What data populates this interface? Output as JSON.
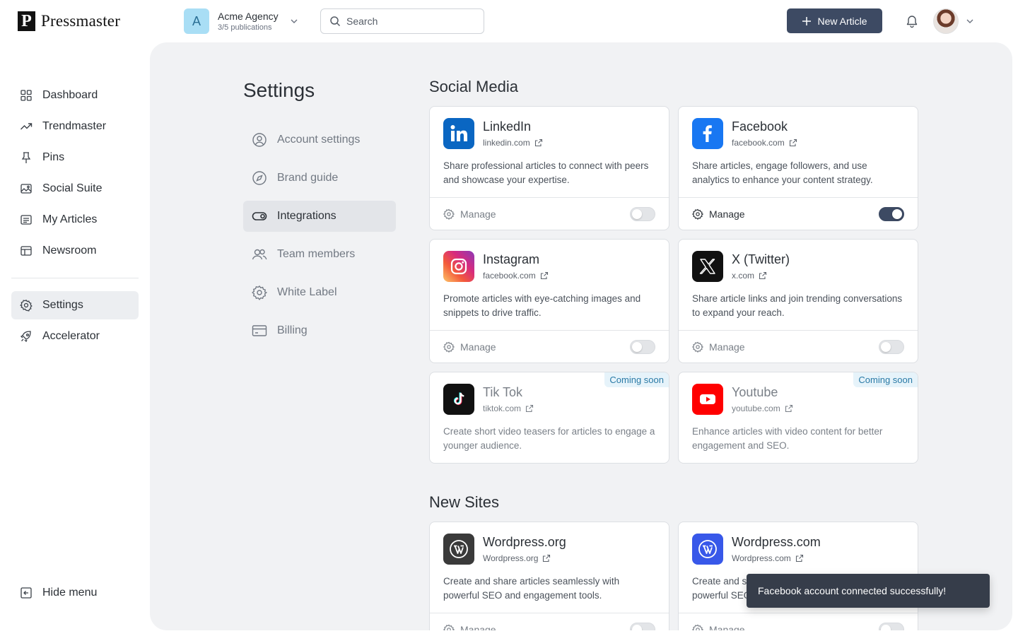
{
  "app": {
    "name": "Pressmaster",
    "logo_letter": "P"
  },
  "org": {
    "avatar": "A",
    "name": "Acme Agency",
    "subtitle": "3/5 publications"
  },
  "search": {
    "placeholder": "Search"
  },
  "header": {
    "new_article_label": "New Article"
  },
  "sidebar": {
    "items": [
      {
        "label": "Dashboard",
        "icon": "grid-icon"
      },
      {
        "label": "Trendmaster",
        "icon": "trend-icon"
      },
      {
        "label": "Pins",
        "icon": "pin-icon"
      },
      {
        "label": "Social Suite",
        "icon": "image-icon"
      },
      {
        "label": "My Articles",
        "icon": "articles-icon"
      },
      {
        "label": "Newsroom",
        "icon": "layout-icon"
      }
    ],
    "secondary": [
      {
        "label": "Settings",
        "icon": "gear-icon",
        "active": true
      },
      {
        "label": "Accelerator",
        "icon": "rocket-icon"
      }
    ],
    "hide_menu": "Hide menu"
  },
  "settings": {
    "title": "Settings",
    "nav": [
      {
        "label": "Account settings",
        "icon": "user-circle-icon"
      },
      {
        "label": "Brand guide",
        "icon": "compass-icon"
      },
      {
        "label": "Integrations",
        "icon": "toggle-icon",
        "active": true
      },
      {
        "label": "Team members",
        "icon": "users-icon"
      },
      {
        "label": "White Label",
        "icon": "gear-icon"
      },
      {
        "label": "Billing",
        "icon": "card-icon"
      }
    ]
  },
  "social": {
    "title": "Social Media",
    "cards": [
      {
        "name": "LinkedIn",
        "url": "linkedin.com",
        "desc": "Share professional articles to connect with peers and showcase your expertise.",
        "manage": "Manage",
        "enabled": false
      },
      {
        "name": "Facebook",
        "url": "facebook.com",
        "desc": "Share articles, engage followers, and use analytics to enhance your content strategy.",
        "manage": "Manage",
        "enabled": true
      },
      {
        "name": "Instagram",
        "url": "facebook.com",
        "desc": "Promote articles with eye-catching images and snippets to drive traffic.",
        "manage": "Manage",
        "enabled": false
      },
      {
        "name": "X (Twitter)",
        "url": "x.com",
        "desc": "Share article links and join trending conversations to expand your reach.",
        "manage": "Manage",
        "enabled": false
      },
      {
        "name": "Tik Tok",
        "url": "tiktok.com",
        "desc": "Create short video teasers for articles to engage a younger audience.",
        "badge": "Coming soon"
      },
      {
        "name": "Youtube",
        "url": "youtube.com",
        "desc": "Enhance articles with video content for better engagement and SEO.",
        "badge": "Coming soon"
      }
    ]
  },
  "sites": {
    "title": "New Sites",
    "cards": [
      {
        "name": "Wordpress.org",
        "url": "Wordpress.org",
        "desc": "Create and share articles seamlessly with powerful SEO and engagement tools.",
        "manage": "Manage",
        "enabled": false
      },
      {
        "name": "Wordpress.com",
        "url": "Wordpress.com",
        "desc": "Create and share articles seamlessly with powerful SEO and engagement tools.",
        "manage": "Manage",
        "enabled": false
      }
    ]
  },
  "toast": {
    "message": "Facebook account connected successfully!"
  },
  "colors": {
    "primary": "#3d4a63",
    "content_bg": "#f1f2f4",
    "badge_text": "#2a7aa6",
    "linkedin": "#0a66c2",
    "facebook": "#1877f2",
    "youtube": "#ff0000",
    "wordpress_com": "#3858e9"
  }
}
